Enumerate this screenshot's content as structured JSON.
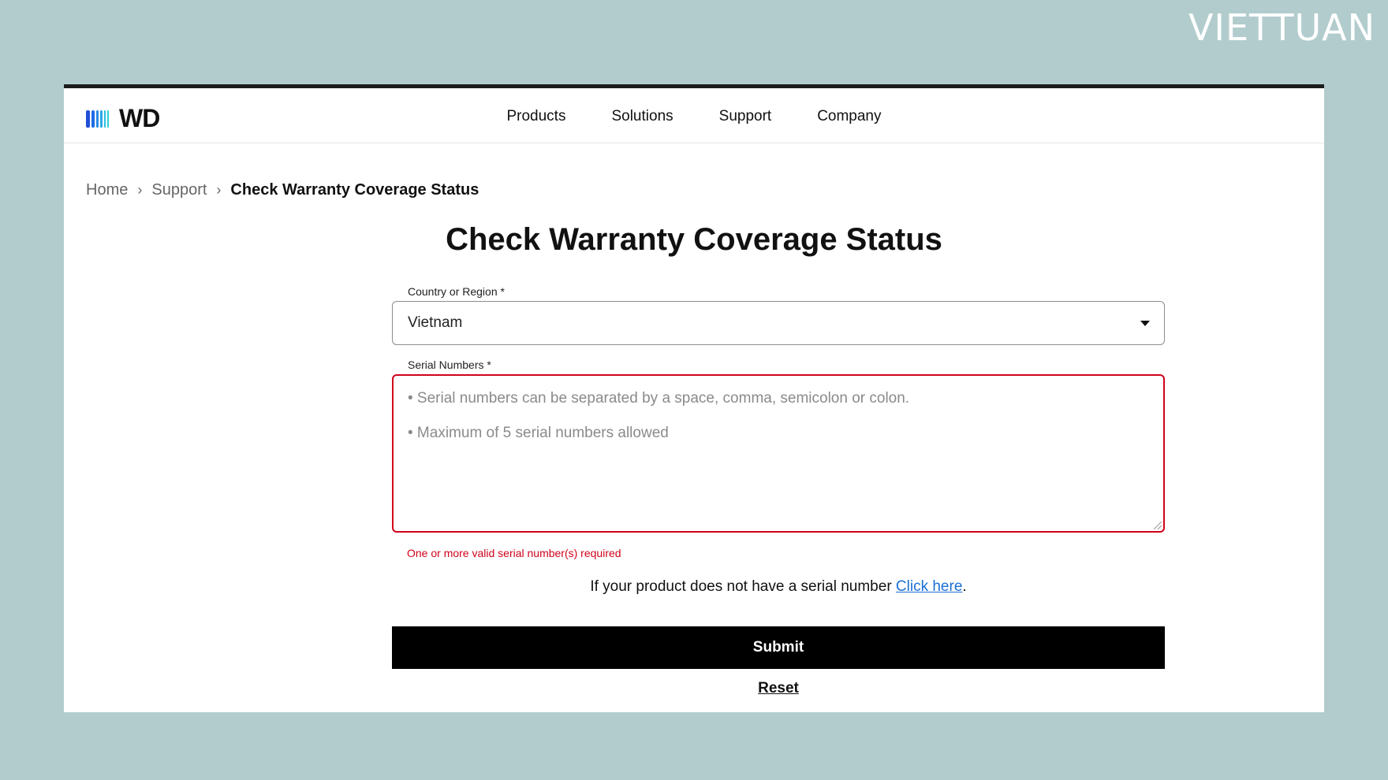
{
  "watermark": "VIETTUAN",
  "header": {
    "logo_text": "WD",
    "nav": [
      "Products",
      "Solutions",
      "Support",
      "Company"
    ]
  },
  "breadcrumb": {
    "home": "Home",
    "support": "Support",
    "current": "Check Warranty Coverage Status"
  },
  "page_title": "Check Warranty Coverage Status",
  "form": {
    "country_label": "Country or Region *",
    "country_value": "Vietnam",
    "serial_label": "Serial Numbers *",
    "serial_placeholder_1": "• Serial numbers can be separated by a space, comma, semicolon or colon.",
    "serial_placeholder_2": "• Maximum of 5 serial numbers allowed",
    "error": "One or more valid serial number(s) required",
    "help_prefix": "If your product does not have a serial number ",
    "help_link": "Click here",
    "help_suffix": ".",
    "submit": "Submit",
    "reset": "Reset"
  },
  "colors": {
    "background": "#b2cccd",
    "error": "#d0021b",
    "link": "#1b6fd6",
    "logo_blue": "#1e6be6"
  }
}
